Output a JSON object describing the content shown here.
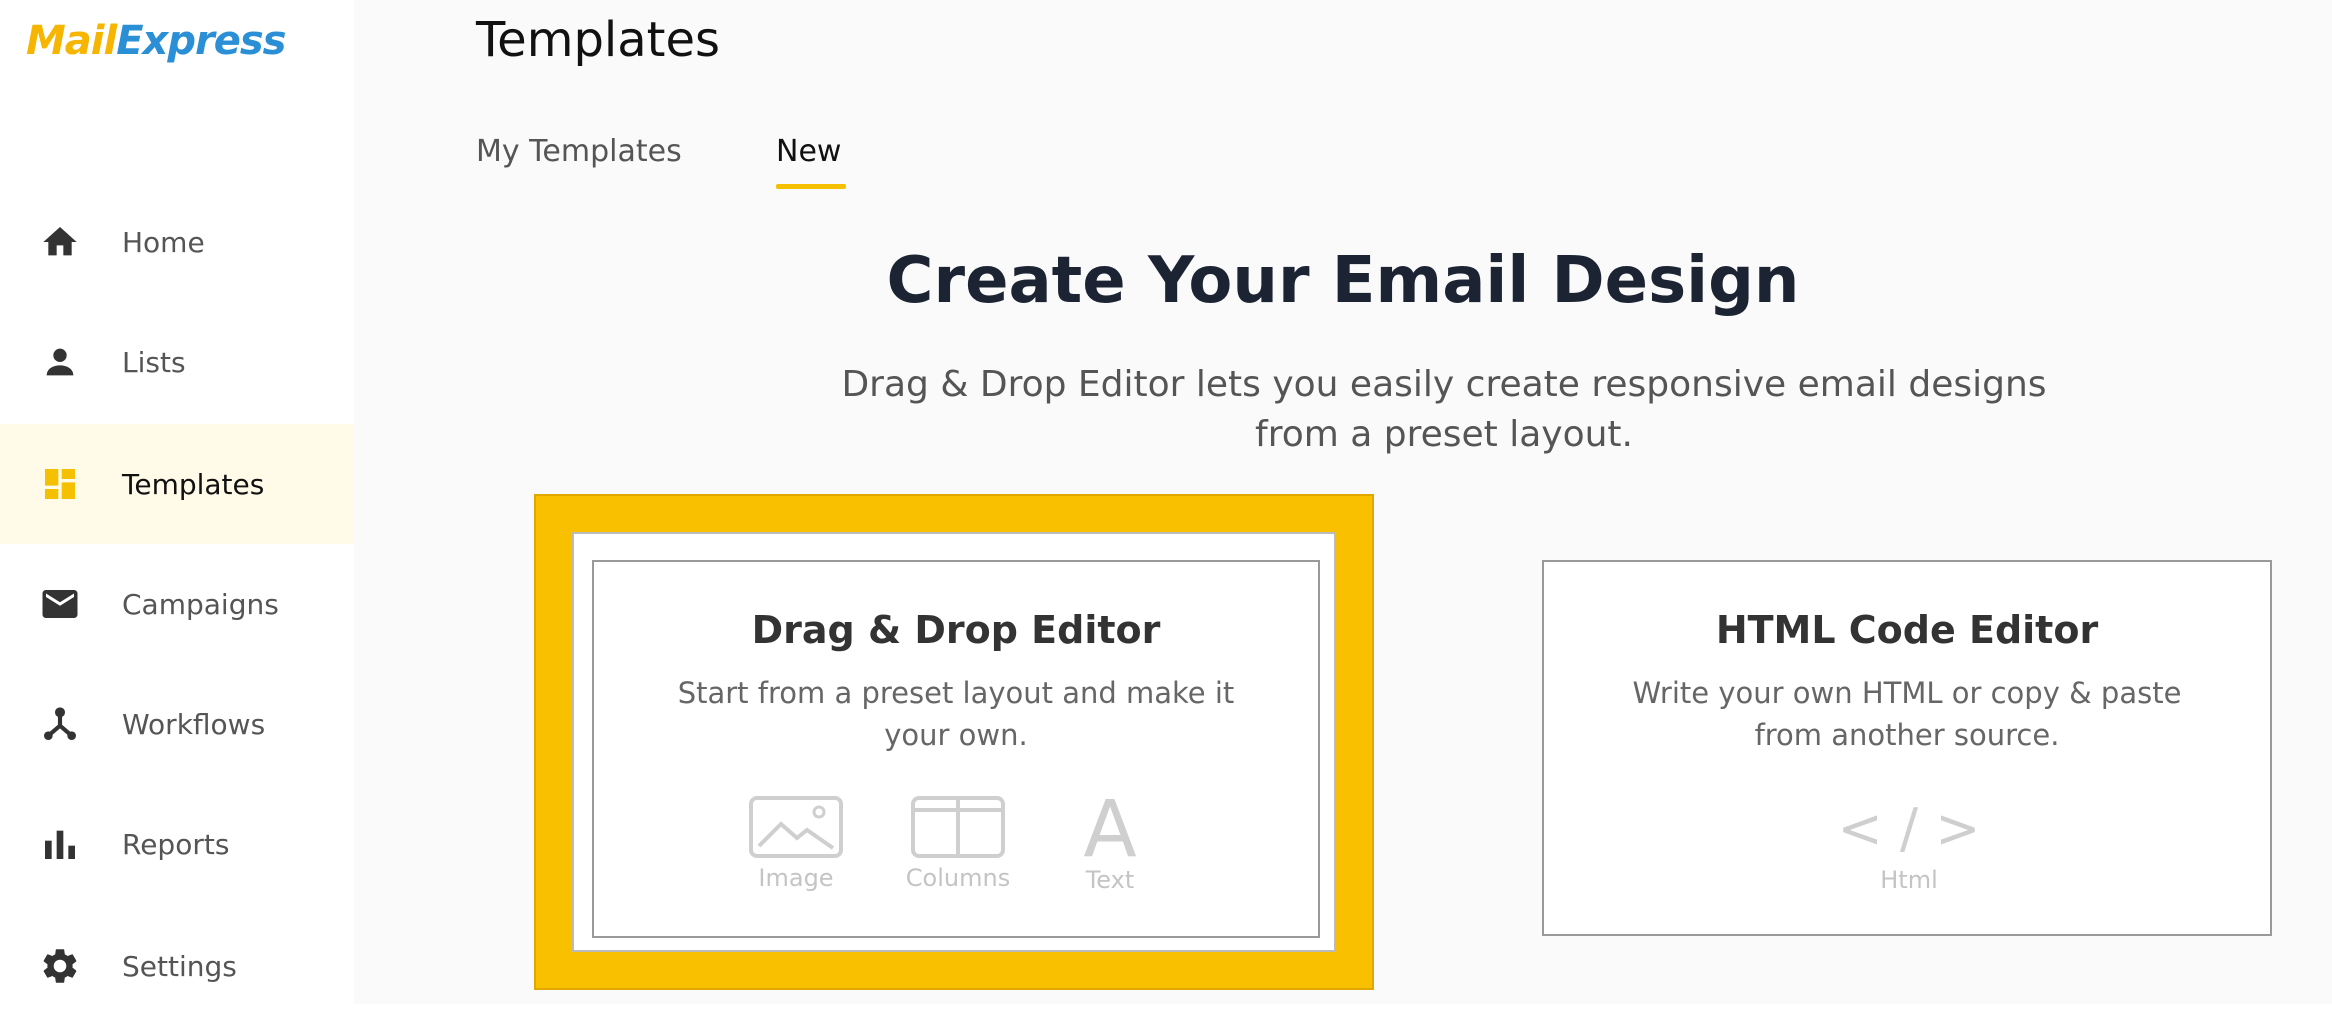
{
  "brand": {
    "logo_part1": "Mail",
    "logo_part2": "Express"
  },
  "sidebar": {
    "items": [
      {
        "label": "Home",
        "icon": "home-icon"
      },
      {
        "label": "Lists",
        "icon": "person-icon"
      },
      {
        "label": "Templates",
        "icon": "dashboard-icon",
        "active": true
      },
      {
        "label": "Campaigns",
        "icon": "mail-icon"
      },
      {
        "label": "Workflows",
        "icon": "workflow-icon"
      },
      {
        "label": "Reports",
        "icon": "bar-chart-icon"
      },
      {
        "label": "Settings",
        "icon": "gear-icon"
      }
    ]
  },
  "header": {
    "title": "Templates"
  },
  "tabs": [
    {
      "label": "My Templates",
      "active": false
    },
    {
      "label": "New",
      "active": true
    }
  ],
  "main": {
    "heading": "Create Your Email Design",
    "subheading_line1": "Drag & Drop Editor lets you easily create responsive email designs",
    "subheading_line2": "from a preset layout."
  },
  "cards": {
    "dragdrop": {
      "title": "Drag & Drop Editor",
      "desc_line1": "Start from a preset layout and make it",
      "desc_line2": "your own.",
      "features": [
        "Image",
        "Columns",
        "Text"
      ],
      "feature_text_glyph": "A"
    },
    "html": {
      "title": "HTML Code Editor",
      "desc_line1": "Write your own HTML or copy & paste",
      "desc_line2": "from another source.",
      "code_glyph": "< / >",
      "feature": "Html"
    }
  },
  "colors": {
    "accent": "#f9c000",
    "logo_blue": "#2b8fd6",
    "logo_yellow": "#f5b500",
    "active_bg": "#fffbe8"
  }
}
